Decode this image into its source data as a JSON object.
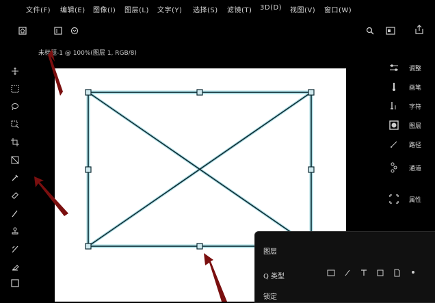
{
  "menu": {
    "items": [
      {
        "label": "文件(F)"
      },
      {
        "label": "编辑(E)"
      },
      {
        "label": "图像(I)"
      },
      {
        "label": "图层(L)"
      },
      {
        "label": "文字(Y)"
      },
      {
        "label": "选择(S)"
      },
      {
        "label": "滤镜(T)"
      },
      {
        "label": "3D(D)"
      },
      {
        "label": "视图(V)"
      },
      {
        "label": "窗口(W)"
      }
    ]
  },
  "document": {
    "info": "未标题-1 @ 100%(图层 1, RGB/8)"
  },
  "right_panel": {
    "items": [
      {
        "label": "调整",
        "icon": "adjust-icon"
      },
      {
        "label": "画笔",
        "icon": "brush-icon"
      },
      {
        "label": "字符",
        "icon": "character-icon"
      },
      {
        "label": "图层",
        "icon": "layers-icon"
      },
      {
        "label": "路径",
        "icon": "paths-icon"
      },
      {
        "label": "通道",
        "icon": "channels-icon"
      },
      {
        "label": "属性",
        "icon": "properties-icon"
      }
    ]
  },
  "popup": {
    "title": "图层",
    "search_label": "Q 类型",
    "lock_label": "锁定"
  },
  "colors": {
    "background": "#000000",
    "canvas": "#ffffff",
    "selection": "#a9dce3",
    "arrow": "#7a0f0f"
  }
}
